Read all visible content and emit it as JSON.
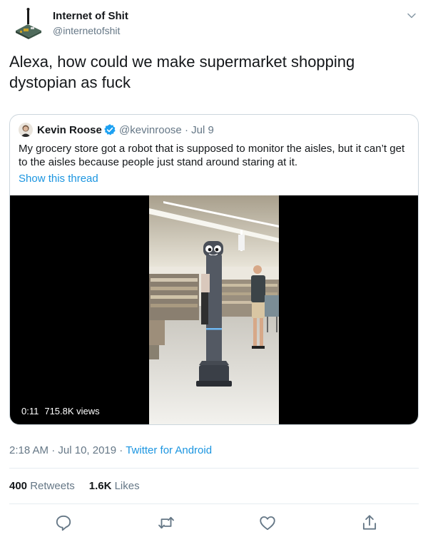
{
  "tweet": {
    "display_name": "Internet of Shit",
    "handle": "@internetofshit",
    "text": "Alexa, how could we make supermarket shopping dystopian as fuck",
    "time": "2:18 AM",
    "date": "Jul 10, 2019",
    "source": "Twitter for Android",
    "separator": " · "
  },
  "quoted": {
    "display_name": "Kevin Roose",
    "handle": "@kevinroose",
    "date": "Jul 9",
    "separator": " · ",
    "text": "My grocery store got a robot that is supposed to monitor the aisles, but it can’t get to the aisles because people just stand around staring at it.",
    "show_thread": "Show this thread",
    "video": {
      "duration": "0:11",
      "views": "715.8K views"
    }
  },
  "stats": {
    "retweets_count": "400",
    "retweets_label": "Retweets",
    "likes_count": "1.6K",
    "likes_label": "Likes"
  },
  "icons": {
    "caret": "chevron-down-icon",
    "verified": "verified-badge-icon",
    "reply": "reply-icon",
    "retweet": "retweet-icon",
    "like": "heart-icon",
    "share": "share-icon"
  },
  "colors": {
    "link": "#1b95e0",
    "secondary_text": "#657786",
    "primary_text": "#14171a",
    "border": "#ccd6dd",
    "verified": "#1da1f2"
  }
}
